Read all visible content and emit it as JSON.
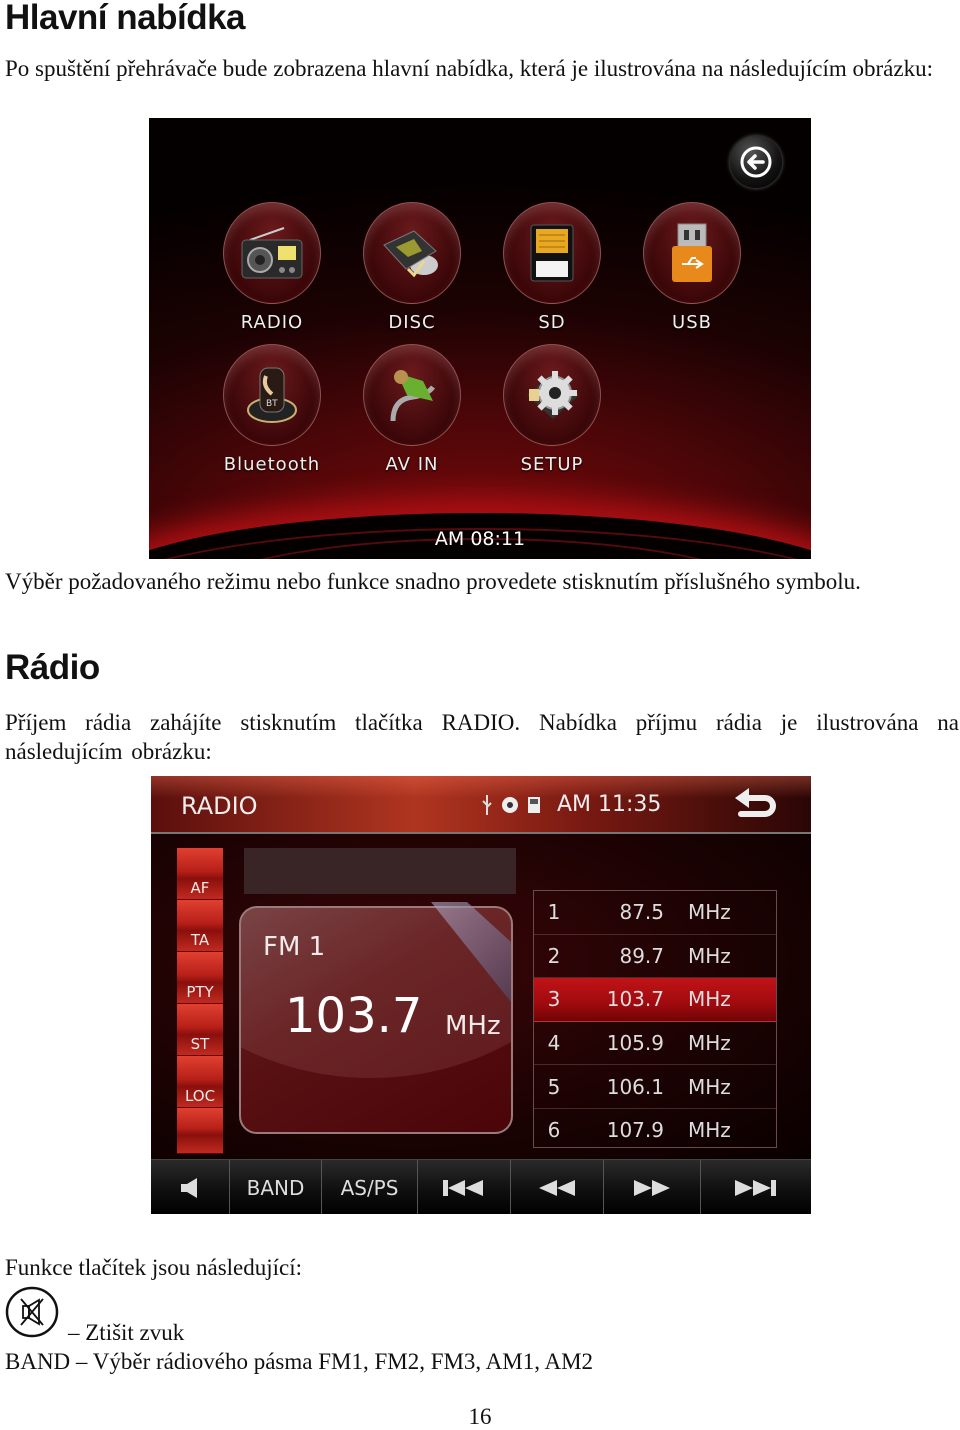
{
  "section1": {
    "heading": "Hlavní nabídka",
    "intro": "Po spuštění přehrávače bude zobrazena hlavní nabídka, která je ilustrována na následujícím obrázku:",
    "caption": "Výběr požadovaného režimu nebo funkce snadno provedete stisknutím příslušného symbolu."
  },
  "main_menu": {
    "back_icon": "circle-arrow-left-icon",
    "tiles": [
      {
        "label": "RADIO",
        "icon": "radio-icon"
      },
      {
        "label": "DISC",
        "icon": "disc-icon"
      },
      {
        "label": "SD",
        "icon": "sd-card-icon"
      },
      {
        "label": "USB",
        "icon": "usb-icon"
      },
      {
        "label": "Bluetooth",
        "icon": "bluetooth-phone-icon"
      },
      {
        "label": "AV IN",
        "icon": "av-in-cable-icon"
      },
      {
        "label": "SETUP",
        "icon": "gear-icon"
      }
    ],
    "clock": "AM 08:11"
  },
  "section2": {
    "heading": "Rádio",
    "intro": "Příjem rádia zahájíte stisknutím tlačítka RADIO. Nabídka příjmu rádia je ilustrována na následujícím obrázku:"
  },
  "radio_screen": {
    "title": "RADIO",
    "status_icons": [
      "usb-icon",
      "disc-icon",
      "sd-card-icon"
    ],
    "clock": "AM 11:35",
    "side_buttons": [
      "AF",
      "TA",
      "PTY",
      "ST",
      "LOC",
      ""
    ],
    "band": "FM 1",
    "frequency": "103.7",
    "unit": "MHz",
    "presets": [
      {
        "num": "1",
        "freq": "87.5",
        "unit": "MHz",
        "active": false
      },
      {
        "num": "2",
        "freq": "89.7",
        "unit": "MHz",
        "active": false
      },
      {
        "num": "3",
        "freq": "103.7",
        "unit": "MHz",
        "active": true
      },
      {
        "num": "4",
        "freq": "105.9",
        "unit": "MHz",
        "active": false
      },
      {
        "num": "5",
        "freq": "106.1",
        "unit": "MHz",
        "active": false
      },
      {
        "num": "6",
        "freq": "107.9",
        "unit": "MHz",
        "active": false
      }
    ],
    "bottom_bar": {
      "mute_icon": "speaker-icon",
      "band_label": "BAND",
      "asps_label": "AS/PS",
      "prev_icon": "skip-previous-icon",
      "rewind_icon": "rewind-icon",
      "forward_icon": "fast-forward-icon",
      "next_icon": "skip-next-icon"
    }
  },
  "functions": {
    "heading": "Funkce tlačítek jsou následující:",
    "mute_desc": "– Ztišit zvuk",
    "band_desc": "BAND – Výběr rádiového pásma FM1, FM2, FM3, AM1, AM2"
  },
  "page_number": "16",
  "colors": {
    "accent_red": "#c01418",
    "screen_bg": "#120203"
  }
}
